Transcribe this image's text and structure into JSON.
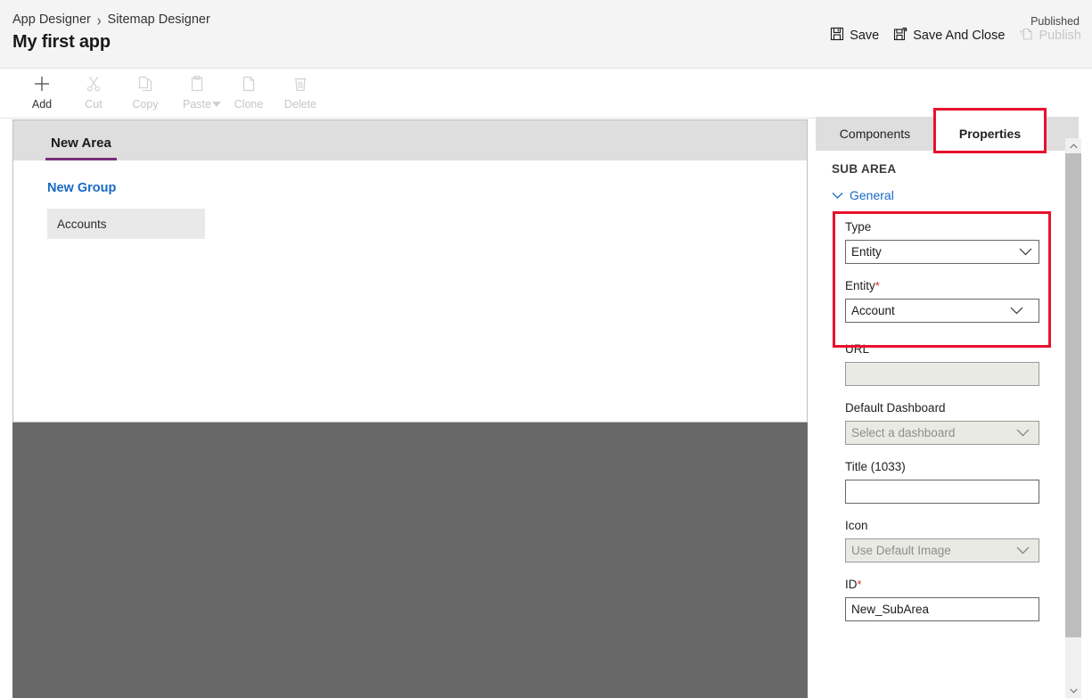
{
  "header": {
    "breadcrumb": [
      "App Designer",
      "Sitemap Designer"
    ],
    "breadcrumb_separator": "›",
    "app_title": "My first app",
    "publish_status": "Published",
    "actions": [
      {
        "label": "Save",
        "icon": "save-icon",
        "disabled": false
      },
      {
        "label": "Save And Close",
        "icon": "save-and-close-icon",
        "disabled": false
      },
      {
        "label": "Publish",
        "icon": "publish-icon",
        "disabled": true
      }
    ]
  },
  "commandbar": {
    "items": [
      {
        "label": "Add",
        "icon": "plus-icon",
        "disabled": false,
        "has_caret": false
      },
      {
        "label": "Cut",
        "icon": "scissors-icon",
        "disabled": true,
        "has_caret": false
      },
      {
        "label": "Copy",
        "icon": "copy-icon",
        "disabled": true,
        "has_caret": false
      },
      {
        "label": "Paste",
        "icon": "clipboard-icon",
        "disabled": true,
        "has_caret": true
      },
      {
        "label": "Clone",
        "icon": "page-icon",
        "disabled": true,
        "has_caret": false
      },
      {
        "label": "Delete",
        "icon": "trash-icon",
        "disabled": true,
        "has_caret": false
      }
    ]
  },
  "canvas": {
    "area_tab": "New Area",
    "group_title": "New Group",
    "subarea": "Accounts"
  },
  "panel": {
    "tabs": [
      {
        "label": "Components",
        "active": false
      },
      {
        "label": "Properties",
        "active": true
      }
    ],
    "section_heading": "SUB AREA",
    "group_label": "General",
    "fields": {
      "type": {
        "label": "Type",
        "value": "Entity"
      },
      "entity": {
        "label": "Entity",
        "required": "*",
        "value": "Account"
      },
      "url": {
        "label": "URL",
        "value": ""
      },
      "default_dashboard": {
        "label": "Default Dashboard",
        "placeholder": "Select a dashboard"
      },
      "title": {
        "label": "Title (1033)",
        "value": ""
      },
      "icon": {
        "label": "Icon",
        "value": "Use Default Image"
      },
      "id": {
        "label": "ID",
        "required": "*",
        "value": "New_SubArea"
      }
    }
  },
  "colors": {
    "accent_purple": "#7a2e7a",
    "link_blue": "#1969c4",
    "annotation_red": "#e8112d",
    "required_red": "#d72b2b",
    "overlay_gray": "#686868"
  }
}
